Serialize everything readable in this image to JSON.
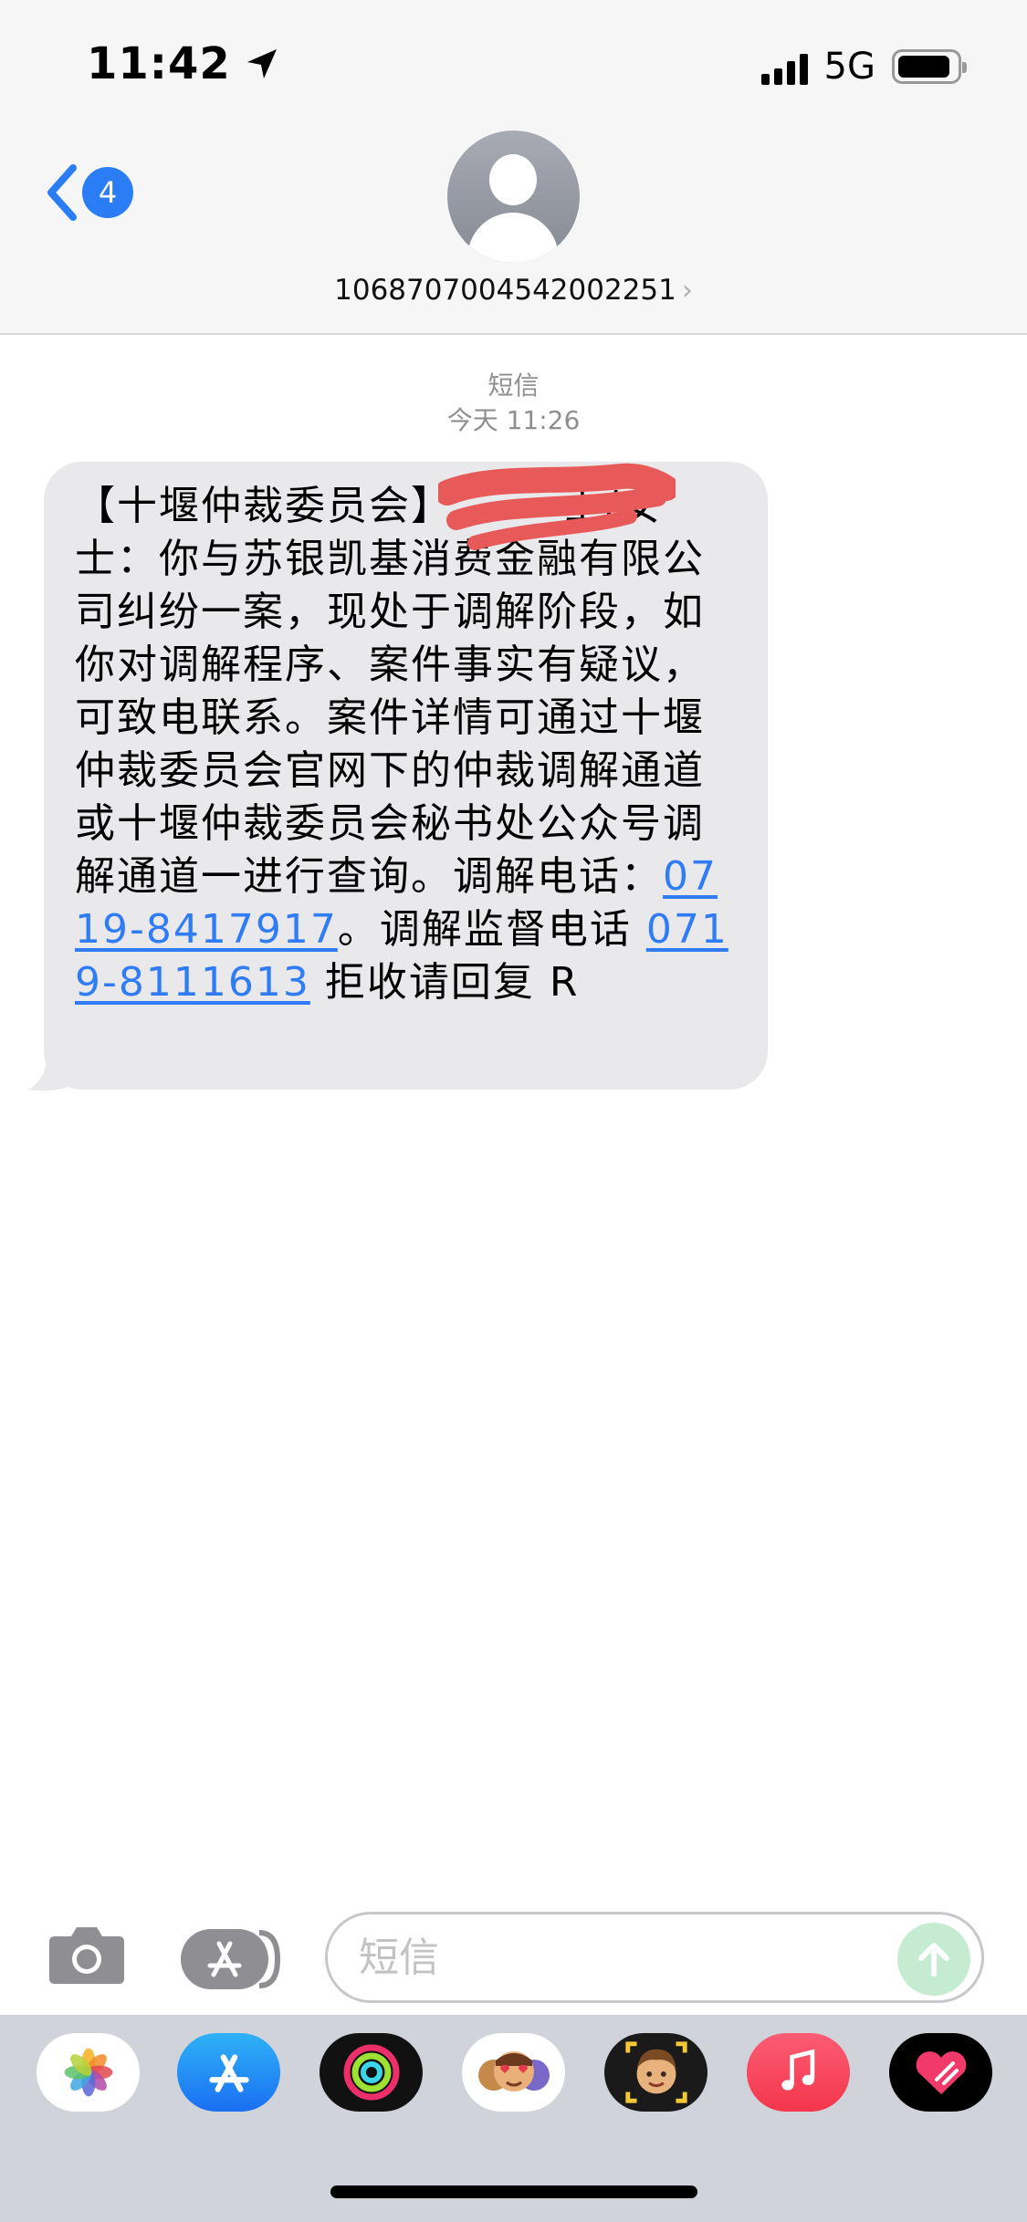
{
  "status_bar": {
    "time": "11:42",
    "network": "5G",
    "icons": [
      "location-arrow-icon",
      "signal-icon",
      "battery-icon"
    ]
  },
  "nav": {
    "back_badge": "4",
    "contact_number": "1068707004542002251",
    "icons": [
      "chevron-left-icon",
      "avatar-icon",
      "chevron-right-icon"
    ]
  },
  "thread": {
    "service": "短信",
    "timestamp": "今天 11:26"
  },
  "message": {
    "seg1": "【十堰仲裁委员会】",
    "seg2": "士/女士：你与苏银凯基消费金融有限公司纠纷一案，现处于调解阶段，如你对调解程序、案件事实有疑议，可致电联系。案件详情可通过十堰仲裁委员会官网下的仲裁调解通道或十堰仲裁委员会秘书处公众号调解通道一进行查询。调解电话：",
    "phone1": "0719-8417917",
    "seg3": "。调解监督电话 ",
    "phone2": "0719-8111613",
    "seg4": " 拒收请回复 R"
  },
  "compose": {
    "placeholder": "短信",
    "icons": [
      "camera-icon",
      "app-store-icon",
      "send-arrow-icon"
    ]
  },
  "app_drawer": {
    "apps": [
      "photos-icon",
      "app-store-icon",
      "fitness-icon",
      "memoji-stickers-icon",
      "memoji-icon",
      "music-icon",
      "digital-touch-icon"
    ]
  },
  "colors": {
    "accent": "#2b7df5",
    "bubble": "#e9e9eb",
    "link": "#2f7cf6",
    "send_disabled": "#c5ecd0",
    "redaction": "#e85a5a"
  }
}
